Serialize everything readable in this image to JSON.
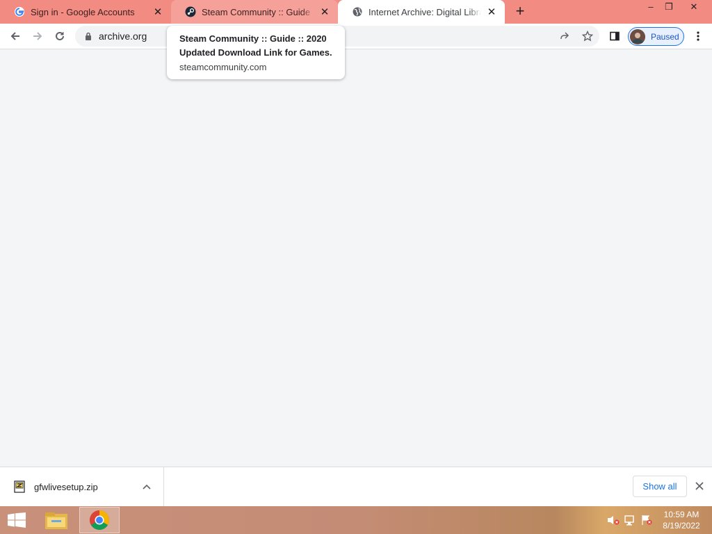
{
  "tabs": [
    {
      "title": "Sign in - Google Accounts",
      "favicon": "google-icon"
    },
    {
      "title": "Steam Community :: Guide :: 2020 Updated Download Link for Games",
      "favicon": "steam-icon"
    },
    {
      "title": "Internet Archive: Digital Library of Free & Borrowable Books",
      "favicon": "globe-icon"
    }
  ],
  "window_controls": {
    "minimize": "–",
    "restore": "❐",
    "close": "✕"
  },
  "new_tab_label": "+",
  "address_bar": {
    "url": "archive.org"
  },
  "profile": {
    "status": "Paused"
  },
  "hovercard": {
    "title_line1": "Steam Community :: Guide :: 2020",
    "title_line2": "Updated Download Link for Games...",
    "domain": "steamcommunity.com"
  },
  "downloads": {
    "file_name": "gfwlivesetup.zip",
    "show_all": "Show all"
  },
  "taskbar": {
    "time": "10:59 AM",
    "date": "8/19/2022"
  },
  "colors": {
    "tab_strip": "#f28b82",
    "active_tab": "#ffffff",
    "content_bg": "#f4f5f7",
    "accent": "#1a73e8"
  }
}
